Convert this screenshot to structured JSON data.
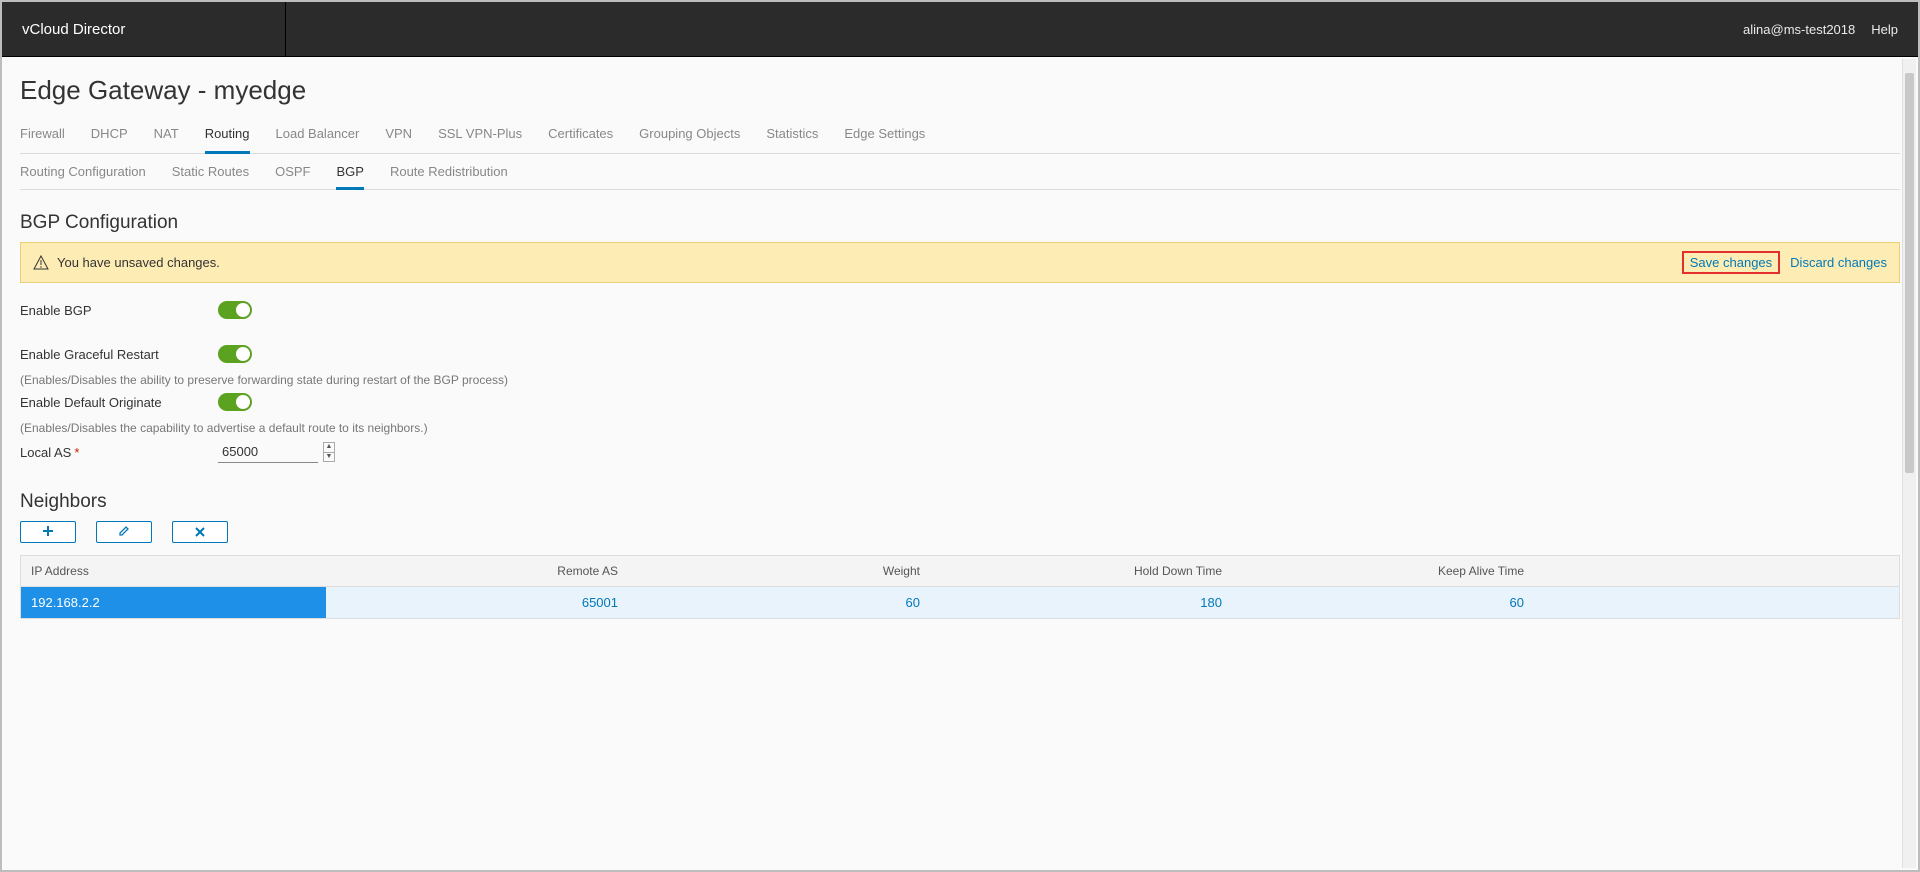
{
  "brand": "vCloud Director",
  "user": "alina@ms-test2018",
  "help_label": "Help",
  "page_title": "Edge Gateway - myedge",
  "tabs_primary": [
    "Firewall",
    "DHCP",
    "NAT",
    "Routing",
    "Load Balancer",
    "VPN",
    "SSL VPN-Plus",
    "Certificates",
    "Grouping Objects",
    "Statistics",
    "Edge Settings"
  ],
  "tabs_primary_active": 3,
  "tabs_secondary": [
    "Routing Configuration",
    "Static Routes",
    "OSPF",
    "BGP",
    "Route Redistribution"
  ],
  "tabs_secondary_active": 3,
  "section_title": "BGP Configuration",
  "alert": {
    "message": "You have unsaved changes.",
    "save": "Save changes",
    "discard": "Discard changes"
  },
  "form": {
    "enable_bgp_label": "Enable BGP",
    "enable_graceful_label": "Enable Graceful Restart",
    "graceful_help": "(Enables/Disables the ability to preserve forwarding state during restart of the BGP process)",
    "enable_default_originate_label": "Enable Default Originate",
    "default_originate_help": "(Enables/Disables the capability to advertise a default route to its neighbors.)",
    "local_as_label": "Local AS",
    "local_as_value": "65000"
  },
  "neighbors": {
    "title": "Neighbors",
    "columns": [
      "IP Address",
      "Remote AS",
      "Weight",
      "Hold Down Time",
      "Keep Alive Time"
    ],
    "rows": [
      {
        "ip": "192.168.2.2",
        "remote_as": "65001",
        "weight": "60",
        "hold": "180",
        "keep": "60"
      }
    ]
  }
}
